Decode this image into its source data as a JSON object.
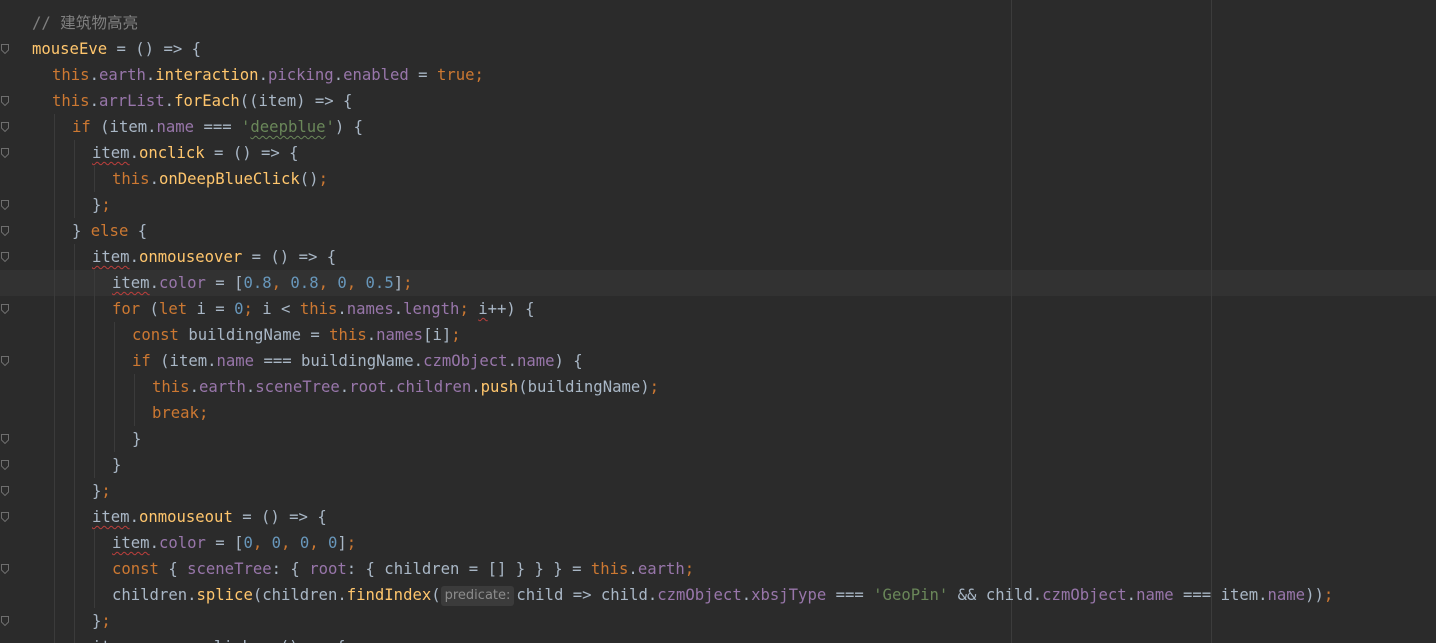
{
  "editor": {
    "lines": [
      [
        {
          "t": "// 建筑物高亮",
          "c": "comment"
        }
      ],
      [
        {
          "t": "mouseEve",
          "c": "fn"
        },
        {
          "t": " = () => {",
          "c": "plain"
        }
      ],
      [
        {
          "t": "this",
          "c": "kw"
        },
        {
          "t": ".",
          "c": "plain"
        },
        {
          "t": "earth",
          "c": "field"
        },
        {
          "t": ".",
          "c": "plain"
        },
        {
          "t": "interaction",
          "c": "fn"
        },
        {
          "t": ".",
          "c": "plain"
        },
        {
          "t": "picking",
          "c": "field"
        },
        {
          "t": ".",
          "c": "plain"
        },
        {
          "t": "enabled",
          "c": "field"
        },
        {
          "t": " = ",
          "c": "plain"
        },
        {
          "t": "true",
          "c": "kw"
        },
        {
          "t": ";",
          "c": "kw"
        }
      ],
      [
        {
          "t": "this",
          "c": "kw"
        },
        {
          "t": ".",
          "c": "plain"
        },
        {
          "t": "arrList",
          "c": "field"
        },
        {
          "t": ".",
          "c": "plain"
        },
        {
          "t": "forEach",
          "c": "fn"
        },
        {
          "t": "((item) => {",
          "c": "plain"
        }
      ],
      [
        {
          "t": "if",
          "c": "kw"
        },
        {
          "t": " (item.",
          "c": "plain"
        },
        {
          "t": "name",
          "c": "field"
        },
        {
          "t": " === ",
          "c": "plain"
        },
        {
          "t": "'",
          "c": "str"
        },
        {
          "t": "deepblue",
          "c": "str squig-green"
        },
        {
          "t": "'",
          "c": "str"
        },
        {
          "t": ") {",
          "c": "plain"
        }
      ],
      [
        {
          "t": "item",
          "c": "plain squig"
        },
        {
          "t": ".",
          "c": "plain"
        },
        {
          "t": "onclick",
          "c": "fn"
        },
        {
          "t": " = () => {",
          "c": "plain"
        }
      ],
      [
        {
          "t": "this",
          "c": "kw"
        },
        {
          "t": ".",
          "c": "plain"
        },
        {
          "t": "onDeepBlueClick",
          "c": "fn"
        },
        {
          "t": "()",
          "c": "plain"
        },
        {
          "t": ";",
          "c": "kw"
        }
      ],
      [
        {
          "t": "}",
          "c": "plain"
        },
        {
          "t": ";",
          "c": "kw"
        }
      ],
      [
        {
          "t": "} ",
          "c": "plain"
        },
        {
          "t": "else",
          "c": "kw"
        },
        {
          "t": " {",
          "c": "plain"
        }
      ],
      [
        {
          "t": "item",
          "c": "plain squig"
        },
        {
          "t": ".",
          "c": "plain"
        },
        {
          "t": "onmouseover",
          "c": "fn"
        },
        {
          "t": " = () => {",
          "c": "plain"
        }
      ],
      [
        {
          "t": "item",
          "c": "plain squig"
        },
        {
          "t": ".",
          "c": "plain"
        },
        {
          "t": "color",
          "c": "field"
        },
        {
          "t": " = [",
          "c": "plain"
        },
        {
          "t": "0.8",
          "c": "num"
        },
        {
          "t": ", ",
          "c": "kw"
        },
        {
          "t": "0.8",
          "c": "num"
        },
        {
          "t": ", ",
          "c": "kw"
        },
        {
          "t": "0",
          "c": "num"
        },
        {
          "t": ", ",
          "c": "kw"
        },
        {
          "t": "0.5",
          "c": "num"
        },
        {
          "t": "]",
          "c": "plain"
        },
        {
          "t": ";",
          "c": "kw"
        }
      ],
      [
        {
          "t": "for",
          "c": "kw"
        },
        {
          "t": " (",
          "c": "plain"
        },
        {
          "t": "let",
          "c": "kw"
        },
        {
          "t": " i = ",
          "c": "plain"
        },
        {
          "t": "0",
          "c": "num"
        },
        {
          "t": "; ",
          "c": "kw"
        },
        {
          "t": "i < ",
          "c": "plain"
        },
        {
          "t": "this",
          "c": "kw"
        },
        {
          "t": ".",
          "c": "plain"
        },
        {
          "t": "names",
          "c": "field"
        },
        {
          "t": ".",
          "c": "plain"
        },
        {
          "t": "length",
          "c": "field"
        },
        {
          "t": "; ",
          "c": "kw"
        },
        {
          "t": "i",
          "c": "plain squig"
        },
        {
          "t": "++) {",
          "c": "plain"
        }
      ],
      [
        {
          "t": "const",
          "c": "kw"
        },
        {
          "t": " buildingName = ",
          "c": "plain"
        },
        {
          "t": "this",
          "c": "kw"
        },
        {
          "t": ".",
          "c": "plain"
        },
        {
          "t": "names",
          "c": "field"
        },
        {
          "t": "[i]",
          "c": "plain"
        },
        {
          "t": ";",
          "c": "kw"
        }
      ],
      [
        {
          "t": "if",
          "c": "kw"
        },
        {
          "t": " (item.",
          "c": "plain"
        },
        {
          "t": "name",
          "c": "field"
        },
        {
          "t": " === buildingName.",
          "c": "plain"
        },
        {
          "t": "czmObject",
          "c": "field"
        },
        {
          "t": ".",
          "c": "plain"
        },
        {
          "t": "name",
          "c": "field"
        },
        {
          "t": ") {",
          "c": "plain"
        }
      ],
      [
        {
          "t": "this",
          "c": "kw"
        },
        {
          "t": ".",
          "c": "plain"
        },
        {
          "t": "earth",
          "c": "field"
        },
        {
          "t": ".",
          "c": "plain"
        },
        {
          "t": "sceneTree",
          "c": "field"
        },
        {
          "t": ".",
          "c": "plain"
        },
        {
          "t": "root",
          "c": "field"
        },
        {
          "t": ".",
          "c": "plain"
        },
        {
          "t": "children",
          "c": "field"
        },
        {
          "t": ".",
          "c": "plain"
        },
        {
          "t": "push",
          "c": "fn"
        },
        {
          "t": "(buildingName)",
          "c": "plain"
        },
        {
          "t": ";",
          "c": "kw"
        }
      ],
      [
        {
          "t": "break",
          "c": "kw"
        },
        {
          "t": ";",
          "c": "kw"
        }
      ],
      [
        {
          "t": "}",
          "c": "plain"
        }
      ],
      [
        {
          "t": "}",
          "c": "plain"
        }
      ],
      [
        {
          "t": "}",
          "c": "plain"
        },
        {
          "t": ";",
          "c": "kw"
        }
      ],
      [
        {
          "t": "item",
          "c": "plain squig"
        },
        {
          "t": ".",
          "c": "plain"
        },
        {
          "t": "onmouseout",
          "c": "fn"
        },
        {
          "t": " = () => {",
          "c": "plain"
        }
      ],
      [
        {
          "t": "item",
          "c": "plain squig"
        },
        {
          "t": ".",
          "c": "plain"
        },
        {
          "t": "color",
          "c": "field"
        },
        {
          "t": " = [",
          "c": "plain"
        },
        {
          "t": "0",
          "c": "num"
        },
        {
          "t": ", ",
          "c": "kw"
        },
        {
          "t": "0",
          "c": "num"
        },
        {
          "t": ", ",
          "c": "kw"
        },
        {
          "t": "0",
          "c": "num"
        },
        {
          "t": ", ",
          "c": "kw"
        },
        {
          "t": "0",
          "c": "num"
        },
        {
          "t": "]",
          "c": "plain"
        },
        {
          "t": ";",
          "c": "kw"
        }
      ],
      [
        {
          "t": "const",
          "c": "kw"
        },
        {
          "t": " { ",
          "c": "plain"
        },
        {
          "t": "sceneTree",
          "c": "field"
        },
        {
          "t": ": { ",
          "c": "plain"
        },
        {
          "t": "root",
          "c": "field"
        },
        {
          "t": ": { children = [] } } } = ",
          "c": "plain"
        },
        {
          "t": "this",
          "c": "kw"
        },
        {
          "t": ".",
          "c": "plain"
        },
        {
          "t": "earth",
          "c": "field"
        },
        {
          "t": ";",
          "c": "kw"
        }
      ],
      [
        {
          "t": "children.",
          "c": "plain"
        },
        {
          "t": "splice",
          "c": "fn"
        },
        {
          "t": "(children.",
          "c": "plain"
        },
        {
          "t": "findIndex",
          "c": "fn"
        },
        {
          "t": "(",
          "c": "plain"
        },
        {
          "hint": "predicate:"
        },
        {
          "t": "child => child.",
          "c": "plain"
        },
        {
          "t": "czmObject",
          "c": "field"
        },
        {
          "t": ".",
          "c": "plain"
        },
        {
          "t": "xbsjType",
          "c": "field"
        },
        {
          "t": " === ",
          "c": "plain"
        },
        {
          "t": "'GeoPin'",
          "c": "str"
        },
        {
          "t": " && child.",
          "c": "plain"
        },
        {
          "t": "czmObject",
          "c": "field"
        },
        {
          "t": ".",
          "c": "plain"
        },
        {
          "t": "name",
          "c": "field"
        },
        {
          "t": " === item.",
          "c": "plain"
        },
        {
          "t": "name",
          "c": "field"
        },
        {
          "t": "))",
          "c": "plain"
        },
        {
          "t": ";",
          "c": "kw"
        }
      ],
      [
        {
          "t": "}",
          "c": "plain"
        },
        {
          "t": ";",
          "c": "kw"
        }
      ],
      [
        {
          "t": "item.onmouseclick = () => {",
          "c": "plain"
        }
      ]
    ]
  },
  "colors": {
    "background": "#2b2b2b",
    "keyword": "#cc7832",
    "function": "#ffc66d",
    "field": "#9876aa",
    "string": "#6a8759",
    "number": "#6897bb",
    "comment": "#808080",
    "text": "#a9b7c6"
  }
}
